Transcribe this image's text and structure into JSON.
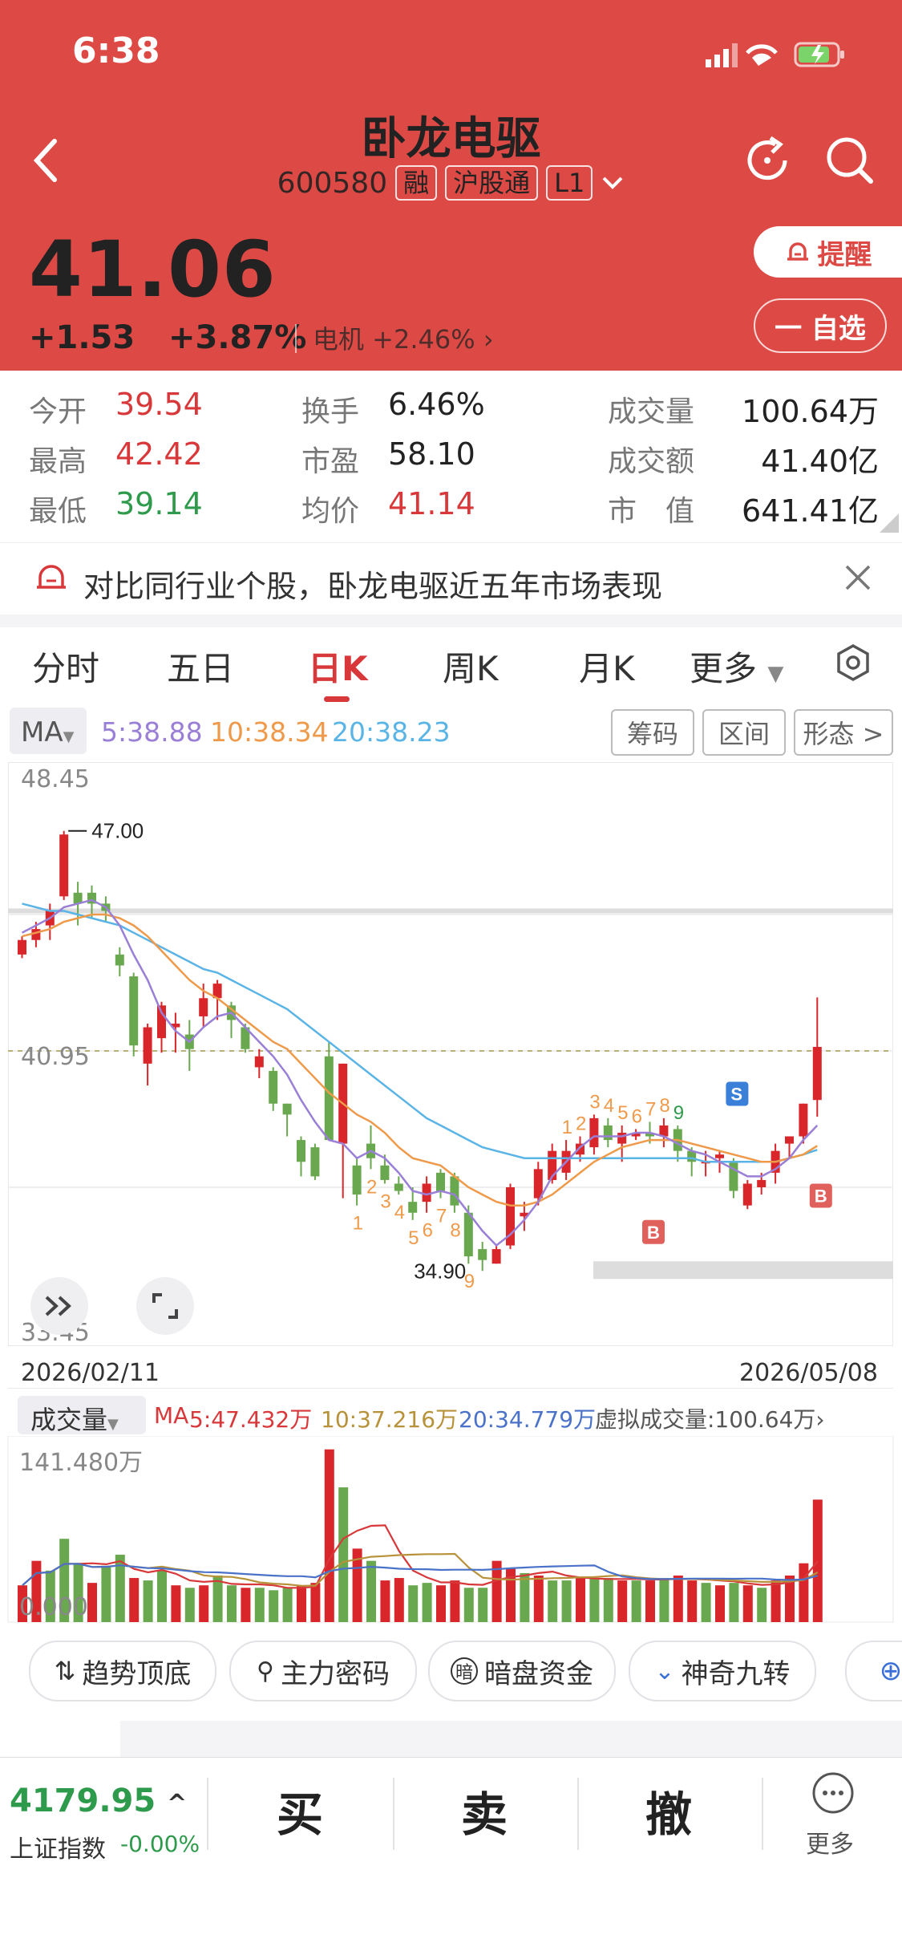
{
  "status": {
    "time": "6:38"
  },
  "stock": {
    "name": "卧龙电驱",
    "code": "600580",
    "tags": [
      "融",
      "沪股通",
      "L1"
    ],
    "price": "41.06",
    "change": "+1.53",
    "change_pct": "+3.87%",
    "sector": "电机 +2.46%"
  },
  "buttons": {
    "remind": "提醒",
    "watch": "一 自选"
  },
  "stats": [
    {
      "label": "今开",
      "value": "39.54",
      "color": "#d8383a"
    },
    {
      "label": "最高",
      "value": "42.42",
      "color": "#d8383a"
    },
    {
      "label": "最低",
      "value": "39.14",
      "color": "#2e9a4b"
    },
    {
      "label": "换手",
      "value": "6.46%",
      "color": "#222222"
    },
    {
      "label": "市盈",
      "value": "58.10",
      "color": "#222222"
    },
    {
      "label": "均价",
      "value": "41.14",
      "color": "#d8383a"
    },
    {
      "label": "成交量",
      "value": "100.64万",
      "color": "#222222"
    },
    {
      "label": "成交额",
      "value": "41.40亿",
      "color": "#222222"
    },
    {
      "label": "市　值",
      "value": "641.41亿",
      "color": "#222222"
    }
  ],
  "banner": {
    "text": "对比同行业个股，卧龙电驱近五年市场表现"
  },
  "tabs": [
    "分时",
    "五日",
    "日K",
    "周K",
    "月K",
    "更多"
  ],
  "ma": {
    "label": "MA",
    "ma5": "5:38.88",
    "ma10": "10:38.34",
    "ma20": "20:38.23",
    "ma5_color": "#9a7fd6",
    "ma10_color": "#ef9a4a",
    "ma20_color": "#5ab4e6"
  },
  "tools": [
    "筹码",
    "区间",
    "形态 >"
  ],
  "chart_data": {
    "type": "candlestick",
    "y_max_label": "48.45",
    "y_mid_label": "40.95",
    "y_min_label": "33.45",
    "ylim": [
      33.45,
      48.45
    ],
    "x_start": "2026/02/11",
    "x_end": "2026/05/08",
    "high_marker": "47.00",
    "low_marker": "34.90",
    "candles": [
      [
        43.6,
        44.0,
        43.5,
        44.1
      ],
      [
        44.0,
        44.3,
        43.8,
        44.5
      ],
      [
        44.4,
        44.8,
        44.0,
        45.0
      ],
      [
        45.2,
        46.9,
        45.1,
        47.0
      ],
      [
        45.3,
        45.0,
        44.4,
        45.6
      ],
      [
        45.3,
        45.0,
        44.6,
        45.5
      ],
      [
        45.0,
        44.8,
        44.5,
        45.2
      ],
      [
        43.6,
        43.3,
        43.0,
        43.8
      ],
      [
        43.0,
        41.1,
        40.8,
        43.1
      ],
      [
        40.6,
        41.6,
        40.0,
        41.7
      ],
      [
        41.3,
        42.2,
        40.9,
        42.3
      ],
      [
        41.6,
        41.7,
        40.9,
        42.0
      ],
      [
        41.4,
        41.0,
        40.4,
        41.8
      ],
      [
        41.9,
        42.4,
        41.6,
        42.8
      ],
      [
        42.4,
        42.8,
        41.8,
        42.9
      ],
      [
        42.2,
        41.8,
        41.3,
        42.3
      ],
      [
        41.6,
        41.0,
        40.9,
        41.7
      ],
      [
        40.5,
        40.8,
        40.2,
        41.0
      ],
      [
        40.4,
        39.5,
        39.3,
        40.5
      ],
      [
        39.5,
        39.2,
        38.6,
        39.5
      ],
      [
        38.5,
        37.9,
        37.5,
        38.6
      ],
      [
        38.3,
        37.5,
        37.4,
        38.4
      ],
      [
        40.8,
        38.5,
        38.5,
        41.2
      ],
      [
        38.4,
        40.6,
        36.9,
        40.6
      ],
      [
        37.8,
        37.0,
        36.7,
        38.0
      ],
      [
        38.4,
        38.0,
        37.7,
        38.9
      ],
      [
        37.8,
        37.4,
        37.3,
        38.1
      ],
      [
        37.3,
        37.1,
        37.0,
        37.5
      ],
      [
        36.8,
        36.5,
        36.3,
        37.2
      ],
      [
        36.8,
        37.3,
        36.5,
        37.5
      ],
      [
        37.6,
        37.1,
        36.9,
        37.7
      ],
      [
        37.5,
        36.7,
        36.5,
        37.6
      ],
      [
        36.5,
        35.3,
        35.1,
        36.7
      ],
      [
        35.5,
        35.2,
        34.9,
        35.7
      ],
      [
        35.1,
        35.5,
        35.1,
        35.6
      ],
      [
        35.6,
        37.2,
        35.5,
        37.3
      ],
      [
        36.4,
        36.5,
        36.0,
        36.8
      ],
      [
        36.9,
        37.7,
        36.7,
        37.9
      ],
      [
        37.4,
        38.2,
        37.3,
        38.4
      ],
      [
        37.6,
        38.2,
        37.4,
        38.5
      ],
      [
        38.1,
        38.4,
        37.9,
        38.6
      ],
      [
        38.3,
        39.1,
        38.1,
        39.2
      ],
      [
        38.9,
        38.5,
        38.3,
        39.1
      ],
      [
        38.4,
        38.7,
        37.9,
        38.9
      ],
      [
        38.6,
        38.7,
        38.5,
        38.8
      ],
      [
        38.7,
        38.6,
        38.4,
        39.0
      ],
      [
        38.6,
        38.9,
        38.3,
        39.1
      ],
      [
        38.8,
        38.2,
        37.9,
        38.9
      ],
      [
        38.2,
        37.9,
        37.5,
        38.3
      ],
      [
        37.9,
        37.9,
        37.5,
        38.2
      ],
      [
        38.0,
        38.1,
        37.6,
        38.2
      ],
      [
        37.9,
        37.1,
        36.9,
        38.0
      ],
      [
        36.7,
        37.3,
        36.6,
        37.4
      ],
      [
        37.2,
        37.4,
        37.0,
        37.6
      ],
      [
        37.6,
        38.2,
        37.3,
        38.4
      ],
      [
        38.4,
        38.6,
        38.0,
        38.6
      ],
      [
        38.6,
        39.5,
        38.4,
        39.5
      ],
      [
        39.6,
        41.06,
        39.14,
        42.42
      ]
    ],
    "ma5": [
      44.2,
      44.4,
      44.6,
      44.9,
      45.0,
      45.1,
      44.9,
      44.4,
      43.6,
      42.9,
      42.0,
      41.5,
      41.2,
      41.6,
      41.9,
      42.0,
      41.6,
      41.2,
      40.8,
      40.3,
      39.6,
      39.0,
      38.5,
      38.4,
      38.0,
      38.2,
      38.0,
      37.6,
      37.1,
      37.0,
      37.1,
      37.0,
      36.5,
      36.0,
      35.6,
      35.9,
      36.3,
      36.8,
      37.5,
      37.9,
      38.3,
      38.6,
      38.6,
      38.6,
      38.7,
      38.7,
      38.6,
      38.4,
      38.2,
      38.1,
      37.9,
      37.7,
      37.5,
      37.5,
      37.7,
      38.0,
      38.5,
      38.9
    ],
    "ma10": [
      44.1,
      44.2,
      44.3,
      44.5,
      44.6,
      44.7,
      44.7,
      44.6,
      44.4,
      44.1,
      43.7,
      43.3,
      42.9,
      42.6,
      42.4,
      42.1,
      41.8,
      41.5,
      41.2,
      41.0,
      40.6,
      40.2,
      39.8,
      39.5,
      39.2,
      39.0,
      38.7,
      38.3,
      38.0,
      37.9,
      37.8,
      37.5,
      37.2,
      37.0,
      36.8,
      36.7,
      36.7,
      36.8,
      37.0,
      37.3,
      37.6,
      37.9,
      38.1,
      38.3,
      38.4,
      38.5,
      38.5,
      38.5,
      38.4,
      38.3,
      38.2,
      38.1,
      38.0,
      37.9,
      37.9,
      38.0,
      38.1,
      38.34
    ],
    "ma20": [
      45.0,
      44.9,
      44.8,
      44.8,
      44.7,
      44.6,
      44.5,
      44.4,
      44.2,
      44.0,
      43.8,
      43.6,
      43.4,
      43.2,
      43.1,
      42.9,
      42.7,
      42.5,
      42.3,
      42.1,
      41.8,
      41.5,
      41.2,
      40.9,
      40.6,
      40.3,
      40.0,
      39.7,
      39.4,
      39.1,
      38.9,
      38.7,
      38.5,
      38.3,
      38.2,
      38.1,
      38.0,
      38.0,
      38.0,
      38.0,
      38.0,
      38.0,
      38.0,
      38.0,
      38.0,
      38.0,
      38.0,
      38.0,
      38.0,
      37.9,
      37.9,
      37.9,
      37.9,
      37.9,
      37.9,
      38.0,
      38.1,
      38.23
    ],
    "nine_turn_down": [
      "1",
      "2",
      "3",
      "4",
      "5",
      "6",
      "7",
      "8",
      "9"
    ],
    "nine_turn_up": [
      "1",
      "2",
      "3",
      "4",
      "5",
      "6",
      "7",
      "8",
      "9"
    ],
    "signals": [
      "B",
      "S",
      "B"
    ]
  },
  "volume": {
    "label": "成交量",
    "ma_label": "MA",
    "ma5": "5:47.432万",
    "ma10": "10:37.216万",
    "ma20": "20:34.779万",
    "virtual": "虚拟成交量:100.64万",
    "max_label": "141.480万",
    "zero_label": "0.000",
    "bars": [
      30,
      50,
      42,
      68,
      48,
      32,
      46,
      55,
      36,
      34,
      42,
      30,
      28,
      30,
      38,
      30,
      28,
      28,
      26,
      28,
      30,
      32,
      141,
      110,
      60,
      50,
      34,
      36,
      30,
      32,
      30,
      34,
      28,
      28,
      50,
      44,
      40,
      38,
      34,
      34,
      36,
      36,
      36,
      34,
      34,
      34,
      36,
      38,
      34,
      32,
      30,
      32,
      30,
      28,
      34,
      38,
      48,
      100
    ],
    "bar_up": [
      1,
      1,
      0,
      0,
      0,
      1,
      0,
      0,
      1,
      0,
      0,
      1,
      0,
      1,
      0,
      0,
      1,
      0,
      0,
      0,
      1,
      1,
      1,
      0,
      1,
      0,
      1,
      1,
      0,
      0,
      1,
      1,
      0,
      0,
      1,
      1,
      0,
      1,
      0,
      0,
      1,
      0,
      0,
      1,
      0,
      1,
      0,
      1,
      1,
      0,
      1,
      0,
      1,
      0,
      1,
      1,
      1,
      1
    ]
  },
  "indicators": [
    "趋势顶底",
    "主力密码",
    "暗盘资金",
    "神奇九转"
  ],
  "bottom": {
    "index_value": "4179.95",
    "index_name": "上证指数",
    "index_change": "-0.00%",
    "buy": "买",
    "sell": "卖",
    "cancel": "撤",
    "more": "更多"
  }
}
